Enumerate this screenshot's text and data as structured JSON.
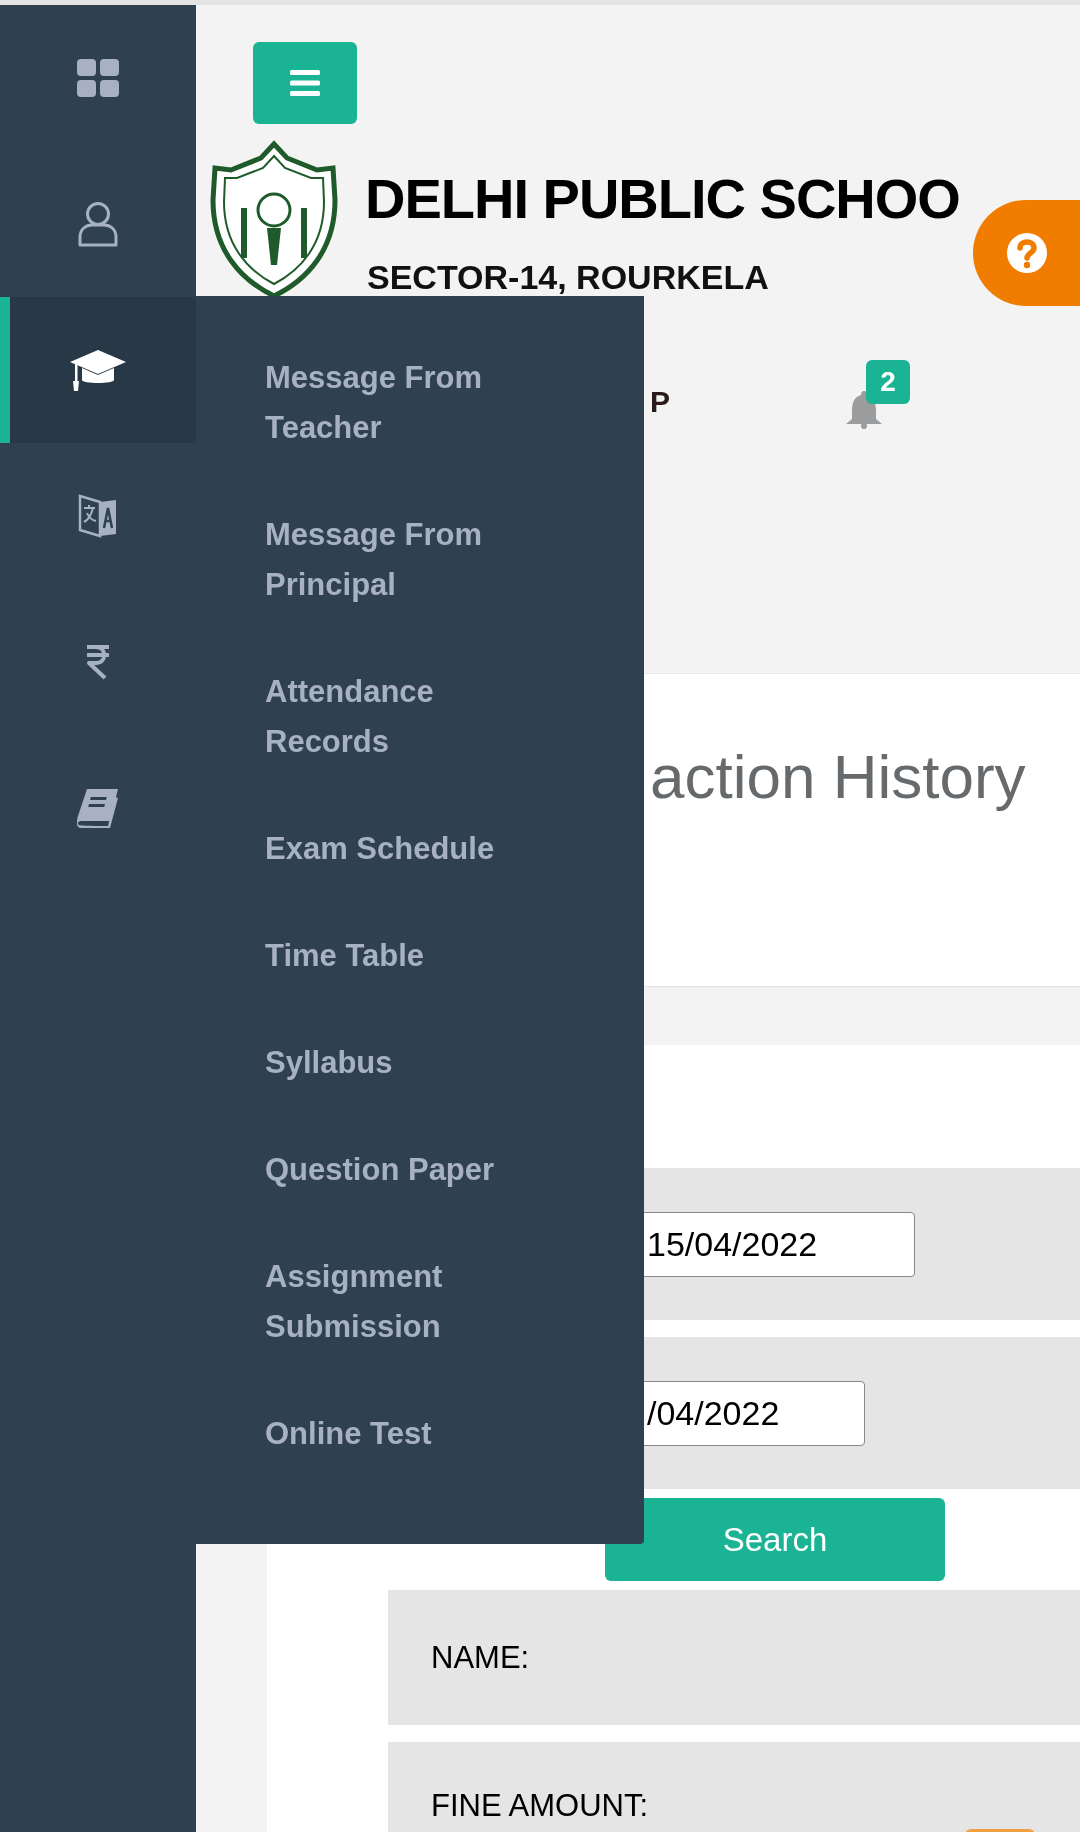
{
  "sidebar": {
    "items": [
      {
        "kind": "dashboard",
        "selected": false
      },
      {
        "kind": "profile",
        "selected": false
      },
      {
        "kind": "academics",
        "selected": true
      },
      {
        "kind": "language",
        "selected": false
      },
      {
        "kind": "fees",
        "selected": false
      },
      {
        "kind": "library",
        "selected": false
      }
    ]
  },
  "submenu": {
    "items": [
      {
        "label": "Message From Teacher"
      },
      {
        "label": "Message From Principal"
      },
      {
        "label": "Attendance Records"
      },
      {
        "label": "Exam Schedule"
      },
      {
        "label": "Time Table"
      },
      {
        "label": "Syllabus"
      },
      {
        "label": "Question Paper"
      },
      {
        "label": "Assignment Submission"
      },
      {
        "label": "Online Test"
      }
    ]
  },
  "header": {
    "school_name": "DELHI PUBLIC SCHOO",
    "school_address": "SECTOR-14, ROURKELA",
    "fragment": "P",
    "notification_count": "2"
  },
  "page": {
    "title": "action History",
    "date_from": {
      "value": "15/04/2022"
    },
    "date_to": {
      "value": "/04/2022"
    },
    "search_button": "Search",
    "fields": [
      {
        "label": "NAME:"
      },
      {
        "label": "FINE AMOUNT:"
      }
    ]
  }
}
